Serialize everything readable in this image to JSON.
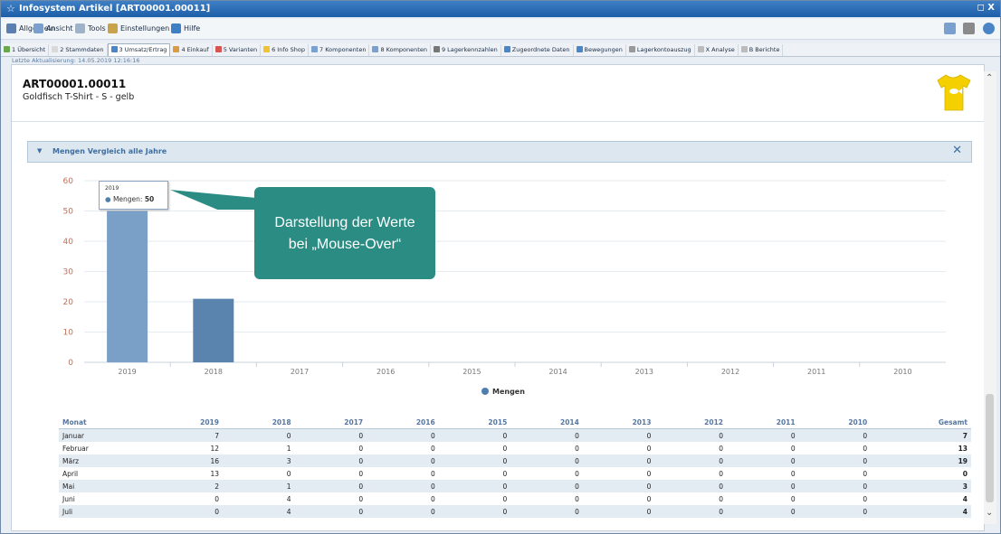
{
  "window": {
    "title": "Infosystem Artikel [ART00001.00011]",
    "controls": "◻ X"
  },
  "menu": [
    {
      "label": "Allgemein",
      "color": "#5a7fb0"
    },
    {
      "label": "Ansicht",
      "color": "#7aa0cf"
    },
    {
      "label": "Tools",
      "color": "#9eb3c9"
    },
    {
      "label": "Einstellungen",
      "color": "#c8a34b"
    },
    {
      "label": "Hilfe",
      "color": "#3f7fc4"
    }
  ],
  "tabs": [
    {
      "label": "1 Übersicht",
      "color": "#6aa84f",
      "active": false
    },
    {
      "label": "2 Stammdaten",
      "color": "#d9d9d9",
      "active": false
    },
    {
      "label": "3 Umsatz/Ertrag",
      "color": "#4a86c5",
      "active": true
    },
    {
      "label": "4 Einkauf",
      "color": "#d99c44",
      "active": false
    },
    {
      "label": "5 Varianten",
      "color": "#d9534f",
      "active": false
    },
    {
      "label": "6 Info Shop",
      "color": "#f1c232",
      "active": false
    },
    {
      "label": "7 Komponenten",
      "color": "#7aa0cf",
      "active": false
    },
    {
      "label": "8 Komponenten",
      "color": "#7aa0cf",
      "active": false
    },
    {
      "label": "9 Lagerkennzahlen",
      "color": "#777",
      "active": false
    },
    {
      "label": "Zugeordnete Daten",
      "color": "#4a86c5",
      "active": false
    },
    {
      "label": "Bewegungen",
      "color": "#4a86c5",
      "active": false
    },
    {
      "label": "Lagerkontoauszug",
      "color": "#999",
      "active": false
    },
    {
      "label": "X Analyse",
      "color": "#bbb",
      "active": false
    },
    {
      "label": "B Berichte",
      "color": "#bbb",
      "active": false
    }
  ],
  "last_update": "Letzte Aktualisierung: 14.05.2019 12:16:16",
  "article": {
    "number": "ART00001.00011",
    "name": "Goldfisch T-Shirt - S - gelb"
  },
  "section": {
    "title": "Mengen Vergleich alle Jahre"
  },
  "tooltip": {
    "year": "2019",
    "label": "Mengen:",
    "value": "50"
  },
  "callout": {
    "line1": "Darstellung der Werte",
    "line2": "bei „Mouse-Over“"
  },
  "chart_data": {
    "type": "bar",
    "categories": [
      "2019",
      "2018",
      "2017",
      "2016",
      "2015",
      "2014",
      "2013",
      "2012",
      "2011",
      "2010"
    ],
    "series": [
      {
        "name": "Mengen",
        "values": [
          50,
          21,
          0,
          0,
          0,
          0,
          0,
          0,
          0,
          0
        ]
      }
    ],
    "ylim": [
      0,
      60
    ],
    "yticks": [
      0,
      10,
      20,
      30,
      40,
      50,
      60
    ],
    "grid": true,
    "legend": "bottom-center",
    "colors": {
      "bar": "#7aa0c8",
      "bar_hover": "#5a84ad"
    }
  },
  "table": {
    "columns": [
      "Monat",
      "2019",
      "2018",
      "2017",
      "2016",
      "2015",
      "2014",
      "2013",
      "2012",
      "2011",
      "2010",
      "Gesamt"
    ],
    "rows": [
      [
        "Januar",
        "7",
        "0",
        "0",
        "0",
        "0",
        "0",
        "0",
        "0",
        "0",
        "0",
        "7"
      ],
      [
        "Februar",
        "12",
        "1",
        "0",
        "0",
        "0",
        "0",
        "0",
        "0",
        "0",
        "0",
        "13"
      ],
      [
        "März",
        "16",
        "3",
        "0",
        "0",
        "0",
        "0",
        "0",
        "0",
        "0",
        "0",
        "19"
      ],
      [
        "April",
        "13",
        "0",
        "0",
        "0",
        "0",
        "0",
        "0",
        "0",
        "0",
        "0",
        "0"
      ],
      [
        "Mai",
        "2",
        "1",
        "0",
        "0",
        "0",
        "0",
        "0",
        "0",
        "0",
        "0",
        "3"
      ],
      [
        "Juni",
        "0",
        "4",
        "0",
        "0",
        "0",
        "0",
        "0",
        "0",
        "0",
        "0",
        "4"
      ],
      [
        "Juli",
        "0",
        "4",
        "0",
        "0",
        "0",
        "0",
        "0",
        "0",
        "0",
        "0",
        "4"
      ]
    ]
  }
}
